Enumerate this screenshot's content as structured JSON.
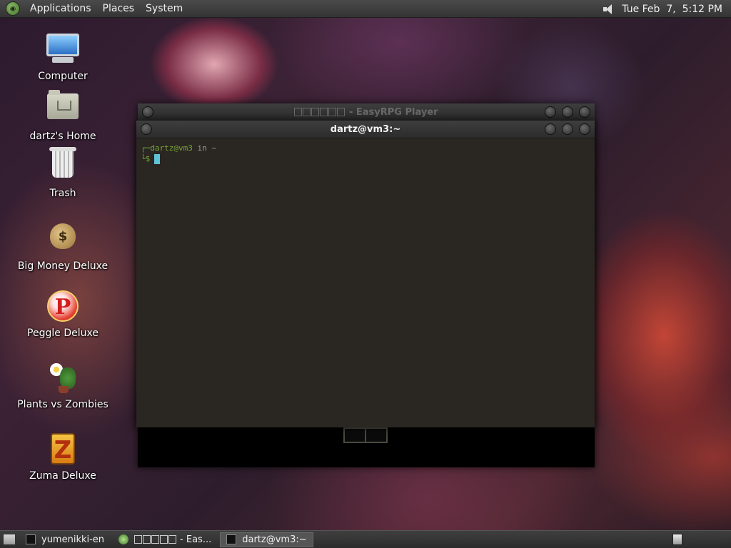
{
  "top_panel": {
    "menus": [
      "Applications",
      "Places",
      "System"
    ],
    "clock": "Tue Feb  7,  5:12 PM"
  },
  "desktop_icons": [
    {
      "label": "Computer",
      "icon": "computer-icon"
    },
    {
      "label": "dartz's Home",
      "icon": "home-folder-icon"
    },
    {
      "label": "Trash",
      "icon": "trash-icon"
    },
    {
      "label": "Big Money Deluxe",
      "icon": "money-bag-icon"
    },
    {
      "label": "Peggle Deluxe",
      "icon": "peggle-icon"
    },
    {
      "label": "Plants vs Zombies",
      "icon": "plants-vs-zombies-icon"
    },
    {
      "label": "Zuma Deluxe",
      "icon": "zuma-icon"
    }
  ],
  "easyrpg_window": {
    "title": "- EasyRPG Player"
  },
  "terminal_window": {
    "title": "dartz@vm3:~",
    "prompt_user": "dartz@vm3",
    "prompt_in": "in ~",
    "prompt_symbol": "$"
  },
  "taskbar": {
    "tasks": [
      {
        "label": "yumenikki-en",
        "active": false
      },
      {
        "label": "- Eas...",
        "active": false
      },
      {
        "label": "dartz@vm3:~",
        "active": true
      }
    ]
  }
}
